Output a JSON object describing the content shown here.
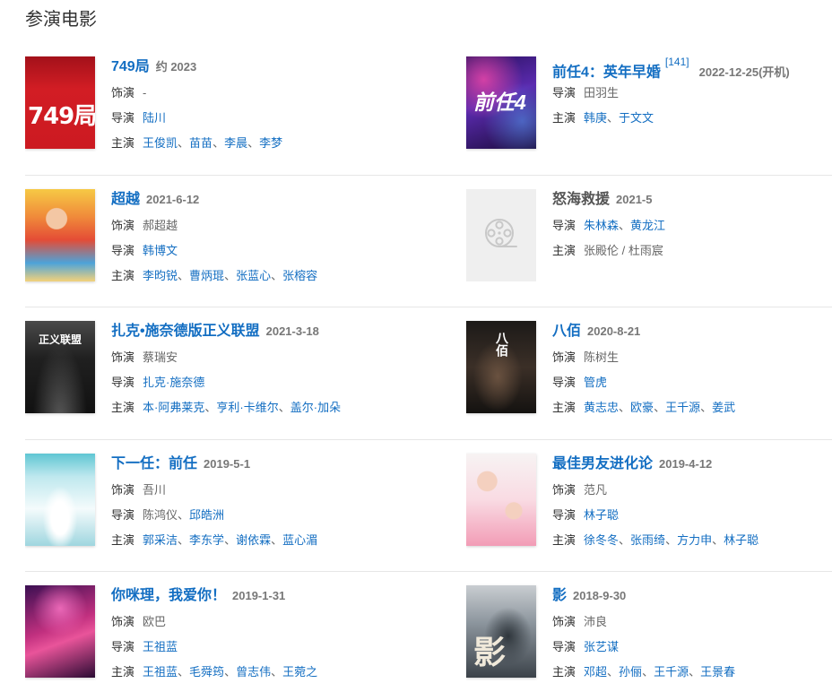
{
  "section_title": "参演电影",
  "labels": {
    "role": "饰演",
    "director": "导演",
    "cast": "主演"
  },
  "colors": {
    "link": "#136ec2",
    "text": "#333333",
    "muted": "#666666",
    "year": "#777777",
    "divider": "#e6e6e6"
  },
  "movies": [
    {
      "title": "749局",
      "title_link": true,
      "year": "约 2023",
      "poster": {
        "text": "749局"
      },
      "role": {
        "sep": "、",
        "names": [
          {
            "text": "-",
            "link": false
          }
        ]
      },
      "director": {
        "sep": "、",
        "names": [
          {
            "text": "陆川",
            "link": true
          }
        ]
      },
      "cast": {
        "sep": "、",
        "names": [
          {
            "text": "王俊凯",
            "link": true
          },
          {
            "text": "苗苗",
            "link": true
          },
          {
            "text": "李晨",
            "link": true
          },
          {
            "text": "李梦",
            "link": true
          }
        ]
      }
    },
    {
      "title": "前任4：英年早婚",
      "title_link": true,
      "ref": "[141]",
      "year": "2022-12-25(开机)",
      "poster": {
        "text": "前任4"
      },
      "director": {
        "sep": "、",
        "names": [
          {
            "text": "田羽生",
            "link": false
          }
        ]
      },
      "cast": {
        "sep": "、",
        "names": [
          {
            "text": "韩庚",
            "link": true
          },
          {
            "text": "于文文",
            "link": true
          }
        ]
      }
    },
    {
      "title": "超越",
      "title_link": true,
      "year": "2021-6-12",
      "poster": {},
      "role": {
        "sep": "、",
        "names": [
          {
            "text": "郝超越",
            "link": false
          }
        ]
      },
      "director": {
        "sep": "、",
        "names": [
          {
            "text": "韩博文",
            "link": true
          }
        ]
      },
      "cast": {
        "sep": "、",
        "names": [
          {
            "text": "李昀锐",
            "link": true
          },
          {
            "text": "曹炳琨",
            "link": true
          },
          {
            "text": "张蓝心",
            "link": true
          },
          {
            "text": "张榕容",
            "link": true
          }
        ]
      }
    },
    {
      "title": "怒海救援",
      "title_link": false,
      "year": "2021-5",
      "poster": {
        "icon": "film-reel-icon"
      },
      "director": {
        "sep": "、",
        "names": [
          {
            "text": "朱林森",
            "link": true
          },
          {
            "text": "黄龙江",
            "link": true
          }
        ]
      },
      "cast": {
        "sep": " / ",
        "names": [
          {
            "text": "张殿伦",
            "link": false
          },
          {
            "text": "杜雨宸",
            "link": false
          }
        ]
      }
    },
    {
      "title": "扎克•施奈德版正义联盟",
      "title_link": true,
      "year": "2021-3-18",
      "poster": {
        "text": "正义联盟"
      },
      "role": {
        "sep": "、",
        "names": [
          {
            "text": "蔡瑞安",
            "link": false
          }
        ]
      },
      "director": {
        "sep": "、",
        "names": [
          {
            "text": "扎克·施奈德",
            "link": true
          }
        ]
      },
      "cast": {
        "sep": "、",
        "names": [
          {
            "text": "本·阿弗莱克",
            "link": true
          },
          {
            "text": "亨利·卡维尔",
            "link": true
          },
          {
            "text": "盖尔·加朵",
            "link": true
          }
        ]
      }
    },
    {
      "title": "八佰",
      "title_link": true,
      "year": "2020-8-21",
      "poster": {
        "text": "八佰"
      },
      "role": {
        "sep": "、",
        "names": [
          {
            "text": "陈树生",
            "link": false
          }
        ]
      },
      "director": {
        "sep": "、",
        "names": [
          {
            "text": "管虎",
            "link": true
          }
        ]
      },
      "cast": {
        "sep": "、",
        "names": [
          {
            "text": "黄志忠",
            "link": true
          },
          {
            "text": "欧豪",
            "link": true
          },
          {
            "text": "王千源",
            "link": true
          },
          {
            "text": "姜武",
            "link": true
          }
        ]
      }
    },
    {
      "title": "下一任：前任",
      "title_link": true,
      "year": "2019-5-1",
      "poster": {},
      "role": {
        "sep": "、",
        "names": [
          {
            "text": "吾川",
            "link": false
          }
        ]
      },
      "director": {
        "sep": "、",
        "names": [
          {
            "text": "陈鸿仪",
            "link": false
          },
          {
            "text": "邱皓洲",
            "link": true
          }
        ]
      },
      "cast": {
        "sep": "、",
        "names": [
          {
            "text": "郭采洁",
            "link": true
          },
          {
            "text": "李东学",
            "link": true
          },
          {
            "text": "谢依霖",
            "link": true
          },
          {
            "text": "蓝心湄",
            "link": true
          }
        ]
      }
    },
    {
      "title": "最佳男友进化论",
      "title_link": true,
      "year": "2019-4-12",
      "poster": {},
      "role": {
        "sep": "、",
        "names": [
          {
            "text": "范凡",
            "link": false
          }
        ]
      },
      "director": {
        "sep": "、",
        "names": [
          {
            "text": "林子聪",
            "link": true
          }
        ]
      },
      "cast": {
        "sep": "、",
        "names": [
          {
            "text": "徐冬冬",
            "link": true
          },
          {
            "text": "张雨绮",
            "link": true
          },
          {
            "text": "方力申",
            "link": true
          },
          {
            "text": "林子聪",
            "link": true
          }
        ]
      }
    },
    {
      "title": "你咪理，我爱你！",
      "title_link": true,
      "year": "2019-1-31",
      "poster": {},
      "role": {
        "sep": "、",
        "names": [
          {
            "text": "欧巴",
            "link": false
          }
        ]
      },
      "director": {
        "sep": "、",
        "names": [
          {
            "text": "王祖蓝",
            "link": true
          }
        ]
      },
      "cast": {
        "sep": "、",
        "names": [
          {
            "text": "王祖蓝",
            "link": true
          },
          {
            "text": "毛舜筠",
            "link": true
          },
          {
            "text": "曾志伟",
            "link": true
          },
          {
            "text": "王菀之",
            "link": true
          }
        ]
      }
    },
    {
      "title": "影",
      "title_link": true,
      "year": "2018-9-30",
      "poster": {
        "text": "影"
      },
      "role": {
        "sep": "、",
        "names": [
          {
            "text": "沛良",
            "link": false
          }
        ]
      },
      "director": {
        "sep": "、",
        "names": [
          {
            "text": "张艺谋",
            "link": true
          }
        ]
      },
      "cast": {
        "sep": "、",
        "names": [
          {
            "text": "邓超",
            "link": true
          },
          {
            "text": "孙俪",
            "link": true
          },
          {
            "text": "王千源",
            "link": true
          },
          {
            "text": "王景春",
            "link": true
          }
        ]
      }
    }
  ]
}
